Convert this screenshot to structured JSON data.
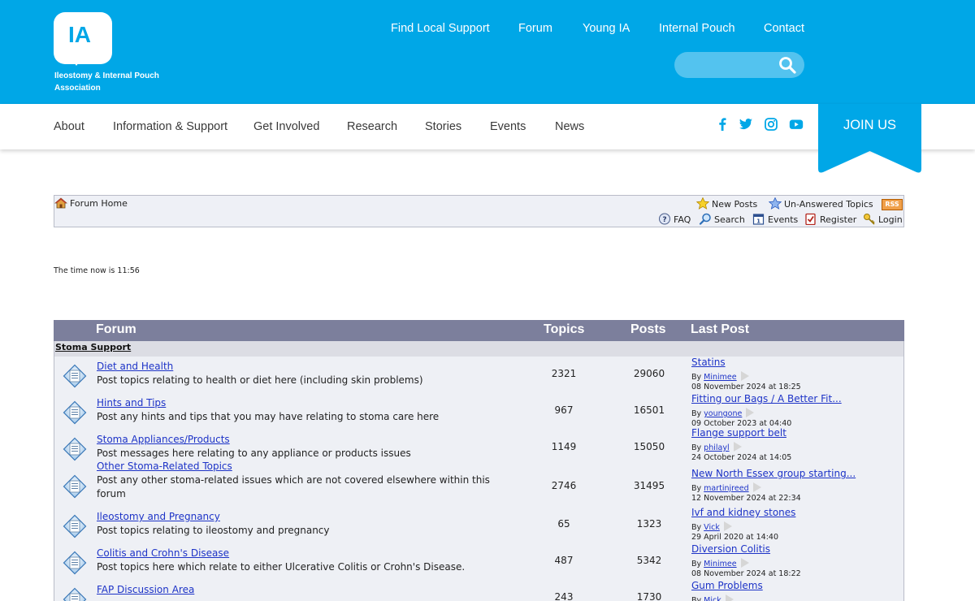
{
  "logo": {
    "mark": "IA",
    "line1": "Ileostomy & Internal Pouch",
    "line2": "Association"
  },
  "top_nav": [
    "Find Local Support",
    "Forum",
    "Young IA",
    "Internal Pouch",
    "Contact"
  ],
  "search": {
    "value": "",
    "placeholder": ""
  },
  "sub_nav": [
    "About",
    "Information & Support",
    "Get Involved",
    "Research",
    "Stories",
    "Events",
    "News"
  ],
  "social_icons": [
    "facebook-icon",
    "twitter-icon",
    "instagram-icon",
    "youtube-icon"
  ],
  "join_label": "JOIN US",
  "toolbar": {
    "home": "Forum Home",
    "new_posts": "New Posts",
    "unanswered": "Un-Answered Topics",
    "rss": "RSS",
    "faq": "FAQ",
    "search": "Search",
    "events": "Events",
    "register": "Register",
    "login": "Login"
  },
  "time_text": "The time now is 11:56",
  "table": {
    "headers": {
      "forum": "Forum",
      "topics": "Topics",
      "posts": "Posts",
      "last_post": "Last Post"
    },
    "category": "Stoma Support",
    "rows": [
      {
        "name": "Diet and Health",
        "desc": "Post topics relating to health or diet here (including skin problems)",
        "topics": "2321",
        "posts": "29060",
        "lp_title": "Statins",
        "lp_by": "By",
        "lp_user": "Minimee",
        "lp_date": "08 November 2024 at 18:25"
      },
      {
        "name": "Hints and Tips",
        "desc": "Post any hints and tips that you may have relating to stoma care here",
        "topics": "967",
        "posts": "16501",
        "lp_title": "Fitting our Bags / A Better Fit...",
        "lp_by": "By",
        "lp_user": "youngone",
        "lp_date": "09 October 2023 at 04:40"
      },
      {
        "name": "Stoma Appliances/Products",
        "desc": "Post messages here relating to any appliance or products issues",
        "topics": "1149",
        "posts": "15050",
        "lp_title": "Flange support belt",
        "lp_by": "By",
        "lp_user": "philayl",
        "lp_date": "24 October 2024 at 14:05"
      },
      {
        "name": "Other Stoma-Related Topics",
        "desc": "Post any other stoma-related issues which are not covered elsewhere within this forum",
        "topics": "2746",
        "posts": "31495",
        "lp_title": "New North Essex group starting...",
        "lp_by": "By",
        "lp_user": "martinjreed",
        "lp_date": "12 November 2024 at 22:34"
      },
      {
        "name": "Ileostomy and Pregnancy",
        "desc": "Post topics relating to ileostomy and pregnancy",
        "topics": "65",
        "posts": "1323",
        "lp_title": "Ivf and kidney stones",
        "lp_by": "By",
        "lp_user": "Vick",
        "lp_date": "29 April 2020 at 14:40"
      },
      {
        "name": "Colitis and Crohn's Disease",
        "desc": "Post topics here which relate to either Ulcerative Colitis or Crohn's Disease.",
        "topics": "487",
        "posts": "5342",
        "lp_title": "Diversion Colitis",
        "lp_by": "By",
        "lp_user": "Minimee",
        "lp_date": "08 November 2024 at 18:22"
      },
      {
        "name": "FAP Discussion Area",
        "desc": "",
        "topics": "243",
        "posts": "1730",
        "lp_title": "Gum Problems",
        "lp_by": "By",
        "lp_user": "Mick",
        "lp_date": ""
      }
    ]
  },
  "colors": {
    "brand_blue": "#00a7e7",
    "table_header": "#7c7f9c",
    "link": "#1d33c7"
  }
}
